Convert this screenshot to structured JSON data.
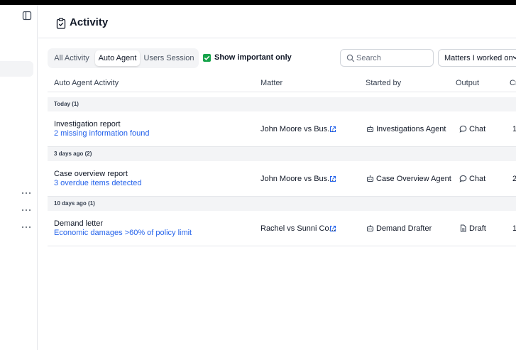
{
  "header": {
    "title": "Activity"
  },
  "tabs": [
    {
      "label": "All Activity",
      "active": false
    },
    {
      "label": "Auto Agent",
      "active": true
    },
    {
      "label": "Users Session",
      "active": false
    }
  ],
  "filter": {
    "important_only_label": "Show important only",
    "important_only_checked": true
  },
  "search": {
    "placeholder": "Search",
    "value": ""
  },
  "matters_filter": {
    "label": "Matters I worked on"
  },
  "table": {
    "columns": [
      "Auto Agent Activity",
      "Matter",
      "Started by",
      "Output",
      "Cr"
    ],
    "groups": [
      {
        "label": "Today (1)",
        "rows": [
          {
            "title": "Investigation report",
            "subtitle": "2 missing information found",
            "matter": "John Moore vs Bus...",
            "started_by": "Investigations Agent",
            "output": "Chat",
            "extra": "1"
          }
        ]
      },
      {
        "label": "3 days ago (2)",
        "rows": [
          {
            "title": "Case overview report",
            "subtitle": "3 overdue items detected",
            "matter": "John Moore vs Bus...",
            "started_by": "Case Overview Agent",
            "output": "Chat",
            "extra": "2"
          }
        ]
      },
      {
        "label": "10 days ago (1)",
        "rows": [
          {
            "title": "Demand letter",
            "subtitle": "Economic damages >60% of policy limit",
            "matter": "Rachel vs Sunni Co...",
            "started_by": "Demand Drafter",
            "output": "Draft",
            "extra": "1,"
          }
        ]
      }
    ]
  },
  "colors": {
    "accent_green": "#16a34a",
    "link_blue": "#2563eb",
    "group_bg": "#f3f4f6"
  },
  "icons": {
    "sidebar": "sidebar-toggle-icon",
    "header": "clipboard-check-icon",
    "agent": "robot-icon",
    "chat": "chat-bubble-icon",
    "draft": "document-icon",
    "external": "external-link-icon",
    "more": "more-horizontal-icon"
  }
}
